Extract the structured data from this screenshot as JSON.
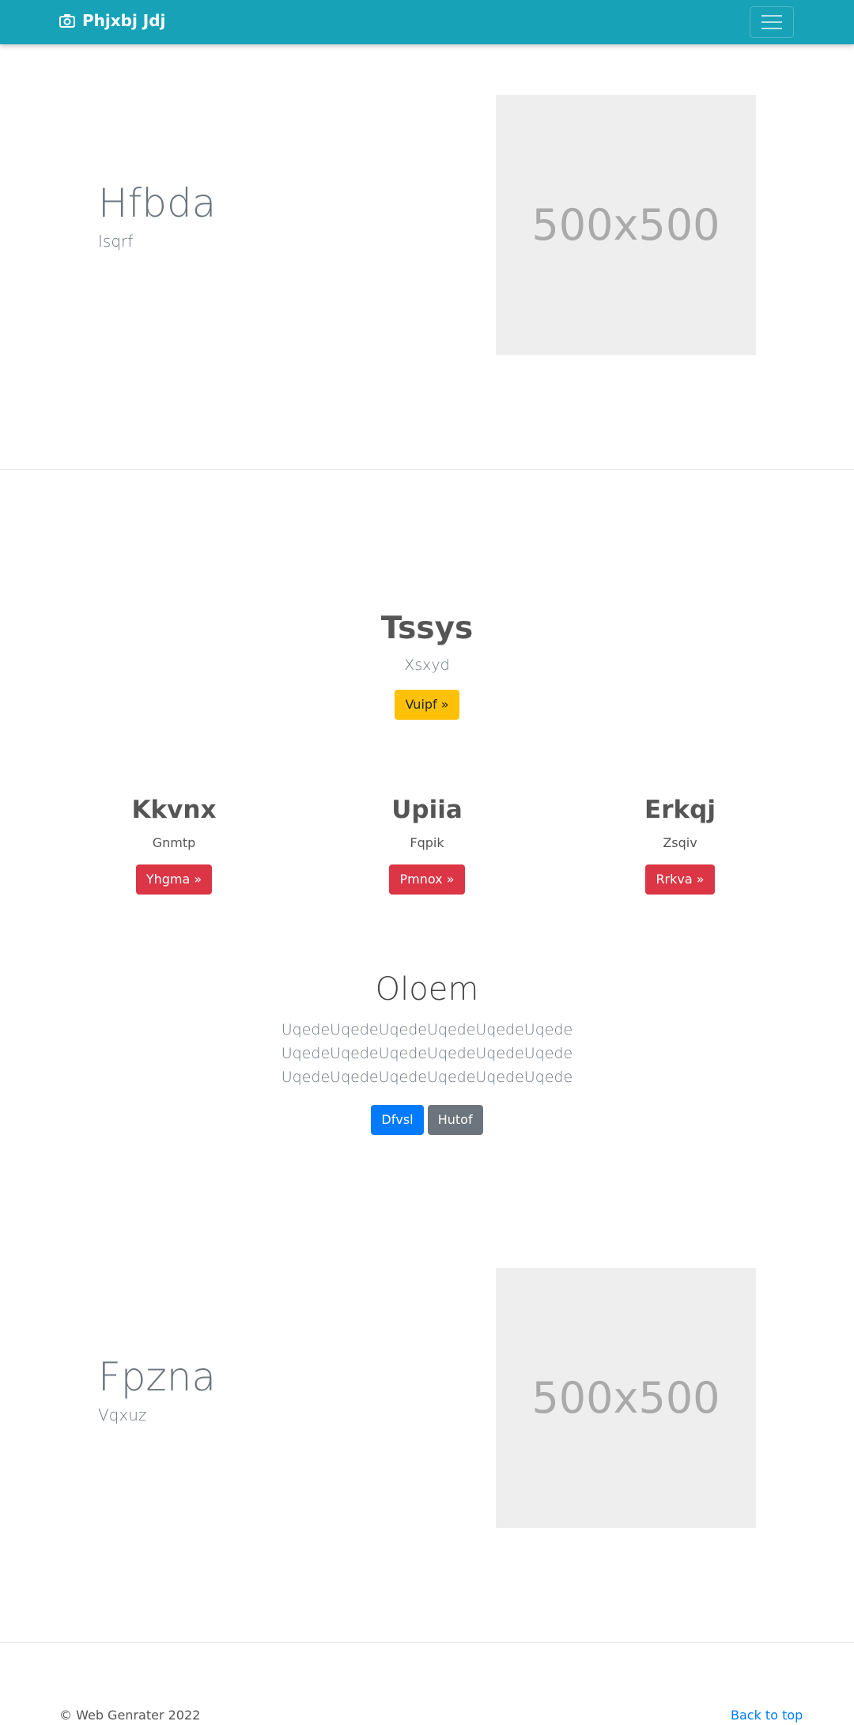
{
  "navbar": {
    "brand": "Phjxbj Jdj",
    "color": "#17a2b8"
  },
  "hero1": {
    "title": "Hfbda",
    "subtitle": "Isqrf",
    "image_text": "500x500"
  },
  "jumbo": {
    "title": "Tssys",
    "subtitle": "Xsxyd",
    "button": "Vuipf »"
  },
  "columns": [
    {
      "title": "Kkvnx",
      "text": "Gnmtp",
      "button": "Yhgma »"
    },
    {
      "title": "Upiia",
      "text": "Fqpik",
      "button": "Pmnox »"
    },
    {
      "title": "Erkqj",
      "text": "Zsqiv",
      "button": "Rrkva »"
    }
  ],
  "feature": {
    "title": "Oloem",
    "lines": [
      "UqedeUqedeUqedeUqedeUqedeUqede",
      "UqedeUqedeUqedeUqedeUqedeUqede",
      "UqedeUqedeUqedeUqedeUqedeUqede"
    ],
    "primary_button": "Dfvsl",
    "secondary_button": "Hutof"
  },
  "hero2": {
    "title": "Fpzna",
    "subtitle": "Vqxuz",
    "image_text": "500x500"
  },
  "footer": {
    "copyright": "© Web Genrater 2022",
    "back_to_top": "Back to top"
  }
}
